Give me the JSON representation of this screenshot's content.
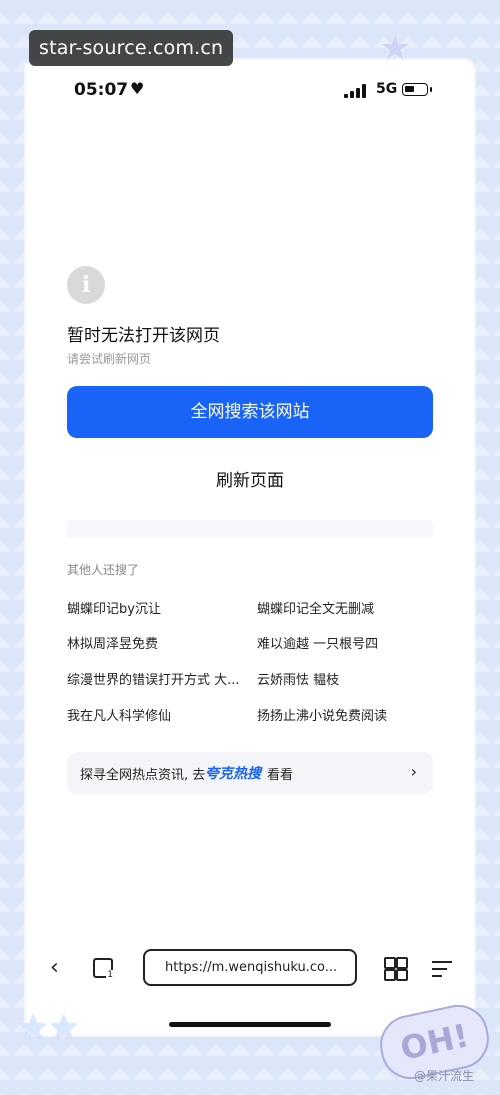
{
  "watermark": "star-source.com.cn",
  "status_bar": {
    "time": "05:07",
    "network": "5G"
  },
  "error": {
    "title": "暂时无法打开该网页",
    "subtitle": "请尝试刷新网页",
    "primary_button": "全网搜索该网站",
    "refresh_button": "刷新页面"
  },
  "others": {
    "title": "其他人还搜了",
    "items": [
      "蝴蝶印记by沉让",
      "蝴蝶印记全文无删减",
      "林拟周泽昱免费",
      "难以逾越 一只根号四",
      "综漫世界的错误打开方式 大...",
      "云娇雨怯 韫枝",
      "我在凡人科学修仙",
      "扬扬止沸小说免费阅读"
    ]
  },
  "hot_bar": {
    "prefix": "探寻全网热点资讯, 去",
    "brand": "夸克热搜",
    "suffix": "看看"
  },
  "toolbar": {
    "url": "https://m.wenqishuku.co...",
    "tab_count": "1"
  },
  "decor": {
    "badge": "OH!",
    "credit": "@果汁流生"
  }
}
